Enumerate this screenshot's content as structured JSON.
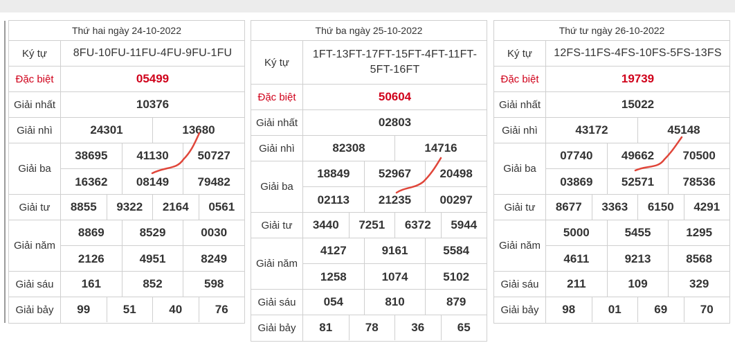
{
  "tables": [
    {
      "date": "Thứ hai ngày 24-10-2022",
      "ky_tu_label": "Ký tự",
      "ky_tu": "8FU-10FU-11FU-4FU-9FU-1FU",
      "labels": {
        "db": "Đặc biệt",
        "g1": "Giải nhất",
        "g2": "Giải nhì",
        "g3": "Giải ba",
        "g4": "Giải tư",
        "g5": "Giải năm",
        "g6": "Giải sáu",
        "g7": "Giải bảy"
      },
      "db": "05499",
      "g1": "10376",
      "g2": [
        "24301",
        "13680"
      ],
      "g3": [
        [
          "38695",
          "41130",
          "50727"
        ],
        [
          "16362",
          "08149",
          "79482"
        ]
      ],
      "g4": [
        "8855",
        "9322",
        "2164",
        "0561"
      ],
      "g5": [
        [
          "8869",
          "8529",
          "0030"
        ],
        [
          "2126",
          "4951",
          "8249"
        ]
      ],
      "g6": [
        "161",
        "852",
        "598"
      ],
      "g7": [
        "99",
        "51",
        "40",
        "76"
      ]
    },
    {
      "date": "Thứ ba ngày 25-10-2022",
      "ky_tu_label": "Ký tự",
      "ky_tu_line1": "1FT-13FT-17FT-15FT-4FT-11FT-",
      "ky_tu_line2": "5FT-16FT",
      "labels": {
        "db": "Đặc biệt",
        "g1": "Giải nhất",
        "g2": "Giải nhì",
        "g3": "Giải ba",
        "g4": "Giải tư",
        "g5": "Giải năm",
        "g6": "Giải sáu",
        "g7": "Giải bảy"
      },
      "db": "50604",
      "g1": "02803",
      "g2": [
        "82308",
        "14716"
      ],
      "g3": [
        [
          "18849",
          "52967",
          "20498"
        ],
        [
          "02113",
          "21235",
          "00297"
        ]
      ],
      "g4": [
        "3440",
        "7251",
        "6372",
        "5944"
      ],
      "g5": [
        [
          "4127",
          "9161",
          "5584"
        ],
        [
          "1258",
          "1074",
          "5102"
        ]
      ],
      "g6": [
        "054",
        "810",
        "879"
      ],
      "g7": [
        "81",
        "78",
        "36",
        "65"
      ]
    },
    {
      "date": "Thứ tư ngày 26-10-2022",
      "ky_tu_label": "Ký tự",
      "ky_tu": "12FS-11FS-4FS-10FS-5FS-13FS",
      "labels": {
        "db": "Đặc biệt",
        "g1": "Giải nhất",
        "g2": "Giải nhì",
        "g3": "Giải ba",
        "g4": "Giải tư",
        "g5": "Giải năm",
        "g6": "Giải sáu",
        "g7": "Giải bảy"
      },
      "db": "19739",
      "g1": "15022",
      "g2": [
        "43172",
        "45148"
      ],
      "g3": [
        [
          "07740",
          "49662",
          "70500"
        ],
        [
          "03869",
          "52571",
          "78536"
        ]
      ],
      "g4": [
        "8677",
        "3363",
        "6150",
        "4291"
      ],
      "g5": [
        [
          "5000",
          "5455",
          "1295"
        ],
        [
          "4611",
          "9213",
          "8568"
        ]
      ],
      "g6": [
        "211",
        "109",
        "329"
      ],
      "g7": [
        "98",
        "01",
        "69",
        "70"
      ]
    }
  ],
  "colors": {
    "special": "#d0021b",
    "ink": "#e0463a",
    "border": "#cfcfcf"
  }
}
